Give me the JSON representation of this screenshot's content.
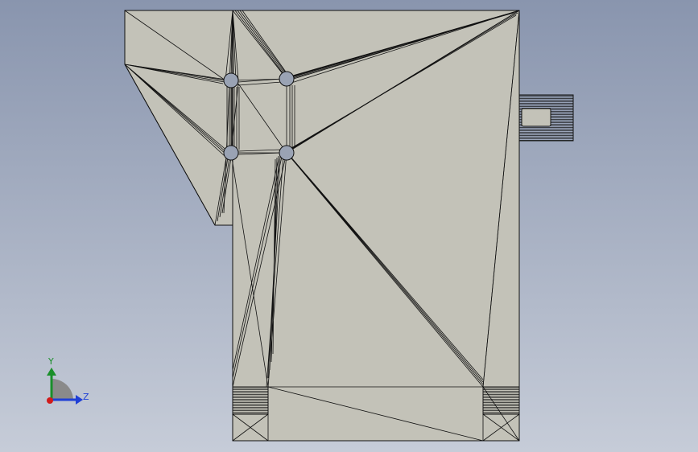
{
  "viewport": {
    "background_top": "#8995ae",
    "background_bottom": "#c6ccd8"
  },
  "model": {
    "face_color": "#c3c2b8",
    "edge_color": "#101010",
    "hole_color": "#9aa3b4"
  },
  "triad": {
    "y_label": "Y",
    "z_label": "Z",
    "y_color": "#1a8f2a",
    "z_color": "#1f3fd6",
    "x_color": "#d11b1b"
  }
}
